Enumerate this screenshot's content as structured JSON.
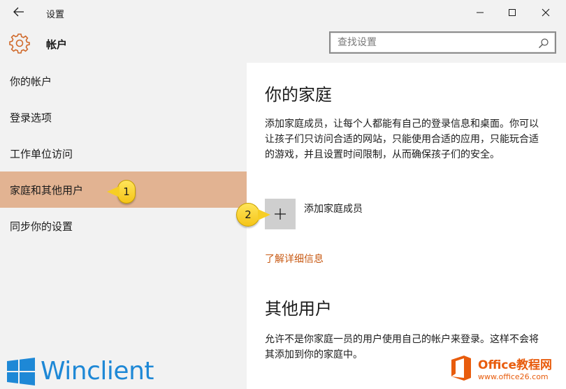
{
  "titlebar": {
    "title": "设置"
  },
  "header": {
    "section_title": "帐户",
    "search_placeholder": "查找设置"
  },
  "sidebar": {
    "items": [
      {
        "label": "你的帐户"
      },
      {
        "label": "登录选项"
      },
      {
        "label": "工作单位访问"
      },
      {
        "label": "家庭和其他用户",
        "selected": true
      },
      {
        "label": "同步你的设置"
      }
    ]
  },
  "main": {
    "family_title": "你的家庭",
    "family_description": "添加家庭成员，让每个人都能有自己的登录信息和桌面。你可以让孩子们只访问合适的网站，只能使用合适的应用，只能玩合适的游戏，并且设置时间限制，从而确保孩子们的安全。",
    "add_family_member": "添加家庭成员",
    "learn_more": "了解详细信息",
    "other_users_title": "其他用户",
    "other_users_description": "允许不是你家庭一员的用户使用自己的帐户来登录。这样不会将其添加到你的家庭中。"
  },
  "callouts": [
    "1",
    "2"
  ],
  "watermarks": {
    "winclient": "Winclient",
    "office_name": "Office教程网",
    "office_url": "www.office26.com"
  },
  "colors": {
    "accent": "#c85a14",
    "selected_nav": "#e2b392",
    "chrome_bg": "#f2f2f2",
    "callout": "#f7ce24"
  }
}
